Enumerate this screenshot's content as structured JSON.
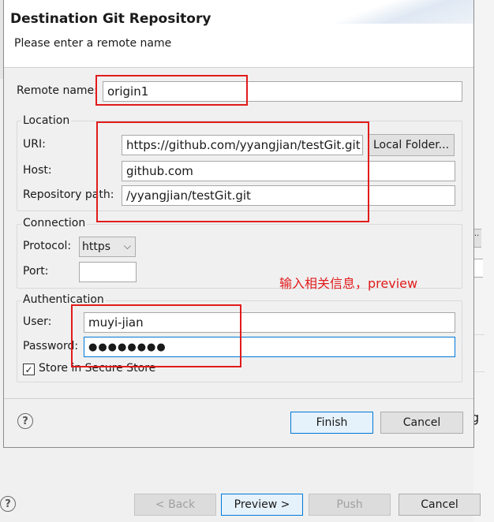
{
  "dialog": {
    "title": "Destination Git Repository",
    "subtitle": "Please enter a remote name"
  },
  "form": {
    "remote_name_label": "Remote name:",
    "remote_name_value": "origin1",
    "location": {
      "title": "Location",
      "uri_label": "URI:",
      "uri_value": "https://github.com/yyangjian/testGit.git",
      "local_folder_button": "Local Folder...",
      "host_label": "Host:",
      "host_value": "github.com",
      "repo_path_label": "Repository path:",
      "repo_path_value": "/yyangjian/testGit.git"
    },
    "connection": {
      "title": "Connection",
      "protocol_label": "Protocol:",
      "protocol_value": "https",
      "port_label": "Port:",
      "port_value": ""
    },
    "authentication": {
      "title": "Authentication",
      "user_label": "User:",
      "user_value": "muyi-jian",
      "password_label": "Password:",
      "password_value": "●●●●●●●●",
      "store_label": "Store in Secure Store",
      "store_checked": "✓"
    }
  },
  "buttons": {
    "finish": "Finish",
    "cancel": "Cancel"
  },
  "background_wizard": {
    "back": "< Back",
    "preview": "Preview >",
    "push": "Push",
    "cancel": "Cancel",
    "right_fragment": "g"
  },
  "annotation": {
    "text": "输入相关信息，preview",
    "color": "#e21b1b"
  },
  "icons": {
    "help": "?",
    "dropdown": "⌵"
  }
}
